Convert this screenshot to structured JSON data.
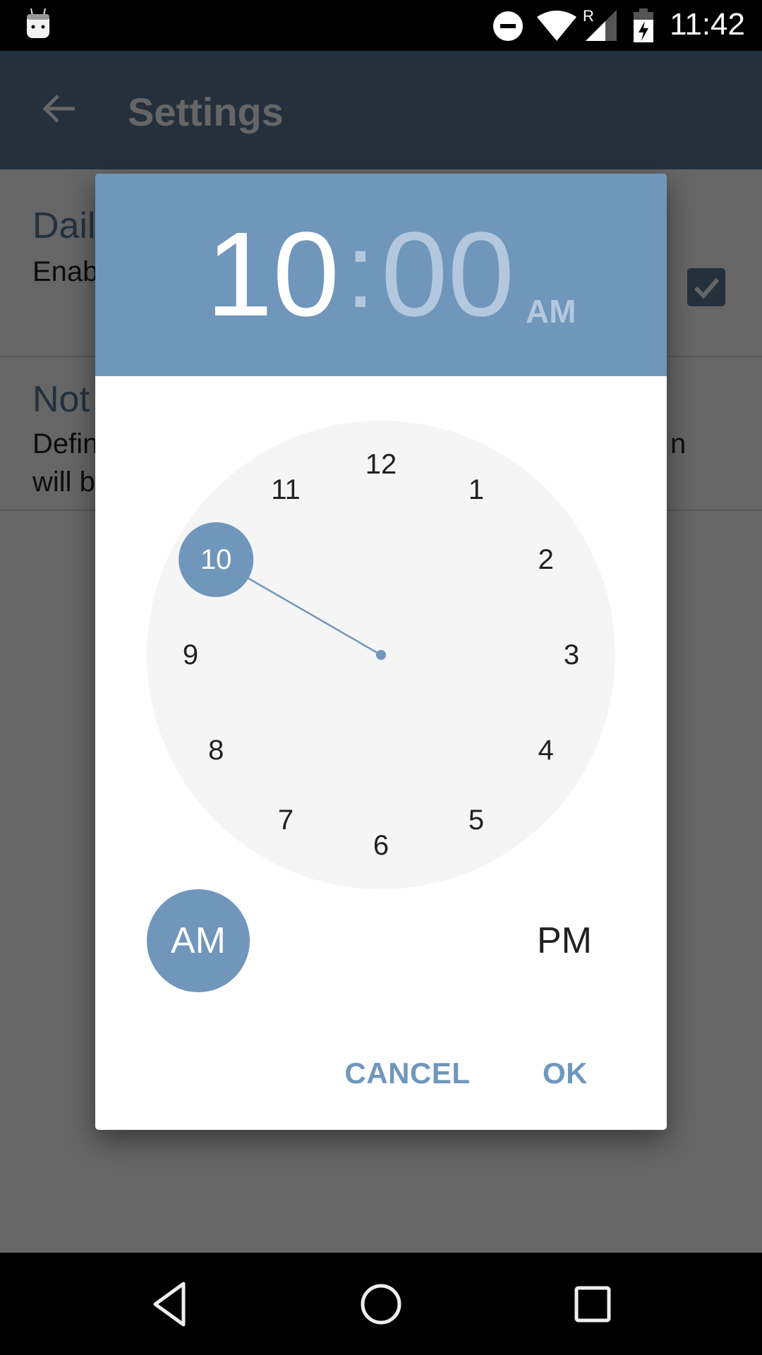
{
  "status_bar": {
    "time": "11:42",
    "icons": [
      "android-notification-icon",
      "do-not-disturb-icon",
      "wifi-icon",
      "roaming-signal-icon",
      "battery-charging-icon"
    ],
    "roaming_label": "R"
  },
  "app": {
    "toolbar": {
      "title": "Settings",
      "back_icon": "arrow-back-icon"
    },
    "preferences": [
      {
        "title": "Dail",
        "summary": "Enab",
        "checked": true
      },
      {
        "title": "Not",
        "summary": "Defin                                                                   n\nwill b"
      }
    ]
  },
  "dialog": {
    "header": {
      "hour": "10",
      "separator": ":",
      "minute": "00",
      "ampm": "AM"
    },
    "clock": {
      "numbers": [
        "12",
        "1",
        "2",
        "3",
        "4",
        "5",
        "6",
        "7",
        "8",
        "9",
        "10",
        "11"
      ],
      "selected": "10",
      "selected_hour": 10
    },
    "am_label": "AM",
    "pm_label": "PM",
    "selected_period": "AM",
    "cancel_label": "CANCEL",
    "ok_label": "OK"
  },
  "colors": {
    "accent": "#7096bb",
    "accent_light": "#b3c8de",
    "clock_face": "#f5f5f5",
    "toolbar": "#2e3d4c"
  },
  "nav_bar": {
    "buttons": [
      "back-icon",
      "home-icon",
      "recents-icon"
    ]
  }
}
